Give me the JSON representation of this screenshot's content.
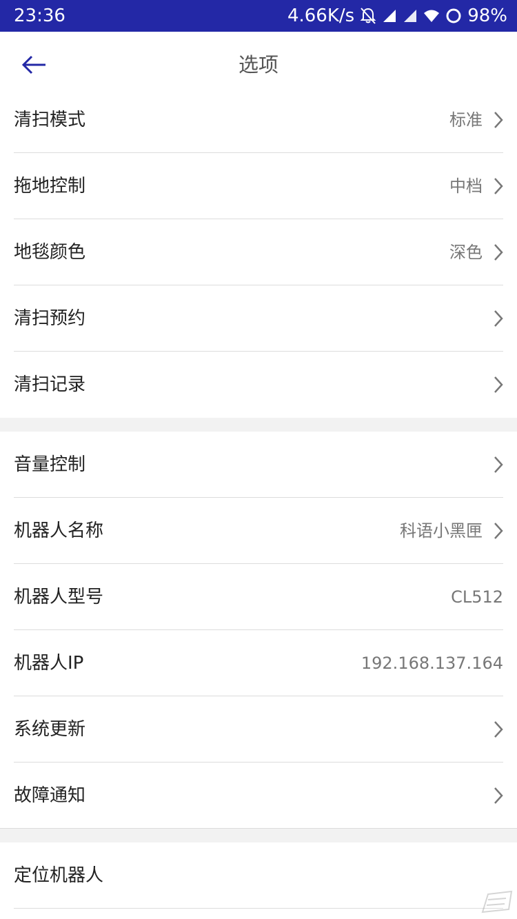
{
  "status_bar": {
    "time": "23:36",
    "net_speed": "4.66K/s",
    "battery": "98%",
    "icons": [
      "bell-off-icon",
      "signal-icon",
      "signal-icon",
      "wifi-icon",
      "battery-ring-icon"
    ]
  },
  "header": {
    "title": "选项",
    "back_icon": "arrow-left-icon"
  },
  "groups": [
    {
      "items": [
        {
          "label": "清扫模式",
          "value": "标准",
          "chevron": true
        },
        {
          "label": "拖地控制",
          "value": "中档",
          "chevron": true
        },
        {
          "label": "地毯颜色",
          "value": "深色",
          "chevron": true
        },
        {
          "label": "清扫预约",
          "value": "",
          "chevron": true
        },
        {
          "label": "清扫记录",
          "value": "",
          "chevron": true
        }
      ]
    },
    {
      "items": [
        {
          "label": "音量控制",
          "value": "",
          "chevron": true
        },
        {
          "label": "机器人名称",
          "value": "科语小黑匣",
          "chevron": true
        },
        {
          "label": "机器人型号",
          "value": "CL512",
          "chevron": false
        },
        {
          "label": "机器人IP",
          "value": "192.168.137.164",
          "chevron": false
        },
        {
          "label": "系统更新",
          "value": "",
          "chevron": true
        },
        {
          "label": "故障通知",
          "value": "",
          "chevron": true
        }
      ]
    },
    {
      "items": [
        {
          "label": "定位机器人",
          "value": "",
          "chevron": false
        }
      ]
    }
  ],
  "colors": {
    "status_bar": "#2328a6",
    "accent": "#2328a6",
    "divider": "#dcdcdc",
    "group_gap": "#f2f2f2"
  }
}
